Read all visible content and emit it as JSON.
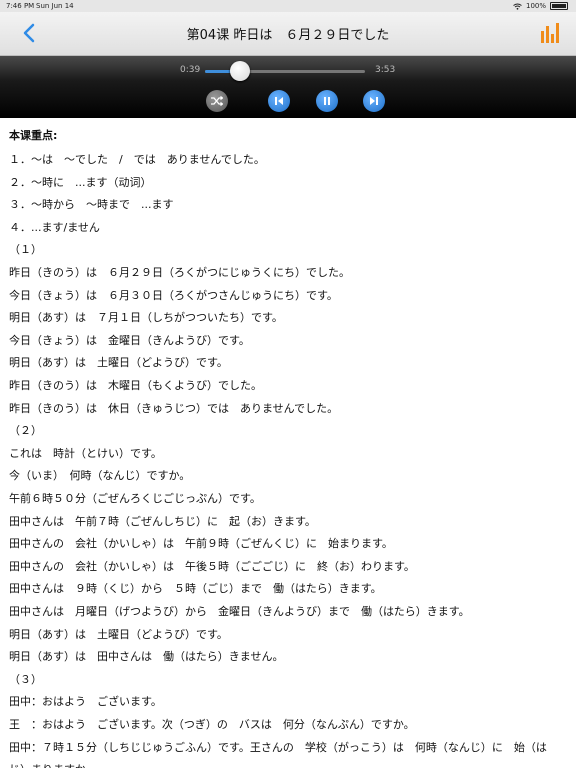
{
  "status": {
    "time": "7:46 PM",
    "date": "Sun Jun 14",
    "battery": "100%"
  },
  "nav": {
    "title": "第04课 昨日は　６月２９日でした",
    "back_icon": "chevron-left-icon",
    "chart_icon": "bar-chart-icon",
    "accent": "#2f8be6",
    "chart_color": "#f08c1a"
  },
  "player": {
    "current_time": "0:39",
    "duration": "3:53",
    "progress": 0.22
  },
  "content": {
    "heading": "本课重点:",
    "lines": [
      "１．～は　～でした　/　では　ありませんでした。",
      "２．～時に　...ます（动词）",
      "３．～時から　～時まで　...ます",
      "４．...ます/ません",
      "（１）",
      "昨日（きのう）は　６月２９日（ろくがつにじゅうくにち）でした。",
      "今日（きょう）は　６月３０日（ろくがつさんじゅうにち）です。",
      "明日（あす）は　７月１日（しちがつついたち）です。",
      "今日（きょう）は　金曜日（きんようび）です。",
      "明日（あす）は　土曜日（どようび）です。",
      "昨日（きのう）は　木曜日（もくようび）でした。",
      "昨日（きのう）は　休日（きゅうじつ）では　ありませんでした。",
      "（２）",
      "これは　時計（とけい）です。",
      "今（いま）　何時（なんじ）ですか。",
      "午前６時５０分（ごぜんろくじごじっぷん）です。",
      "田中さんは　午前７時（ごぜんしちじ）に　起（お）きます。",
      "田中さんの　会社（かいしゃ）は　午前９時（ごぜんくじ）に　始まります。",
      "田中さんの　会社（かいしゃ）は　午後５時（ごごごじ）に　終（お）わります。",
      "田中さんは　９時（くじ）から　５時（ごじ）まで　働（はたら）きます。",
      "田中さんは　月曜日（げつようび）から　金曜日（きんようび）まで　働（はたら）きます。",
      "明日（あす）は　土曜日（どようび）です。",
      "明日（あす）は　田中さんは　働（はたら）きません。",
      "（３）",
      "田中：おはよう　ございます。",
      "王　：おはよう　ございます。次（つぎ）の　バスは　何分（なんぷん）ですか。",
      "田中：７時１５分（しちじじゅうごふん）です。王さんの　学校（がっこう）は　何時（なんじ）に　始（は",
      "じ）まりますか。"
    ]
  }
}
